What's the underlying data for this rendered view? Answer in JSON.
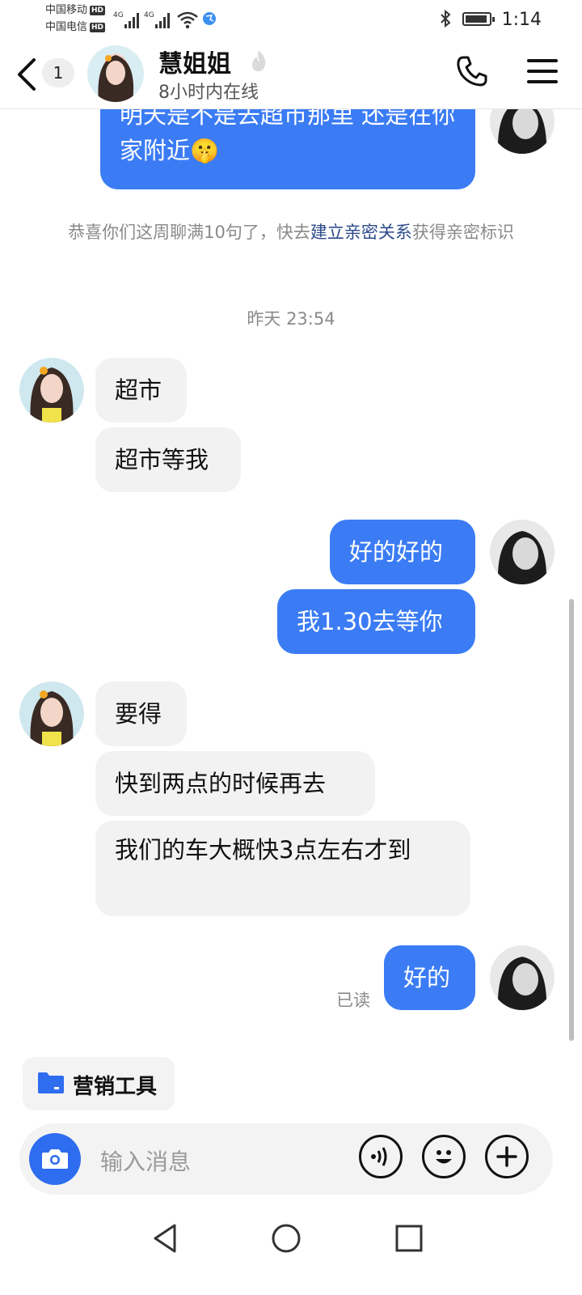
{
  "status_bar": {
    "carrier1": "中国移动",
    "carrier2": "中国电信",
    "hd_label": "HD",
    "network": "4G",
    "time": "1:14"
  },
  "header": {
    "unread_count": "1",
    "contact_name": "慧姐姐",
    "online_status": "8小时内在线"
  },
  "messages": {
    "out_top": "明天是不是去超市那里 还是在你家附近",
    "sys_notice_before": "恭喜你们这周聊满10句了，快去",
    "sys_notice_link": "建立亲密关系",
    "sys_notice_after": "获得亲密标识",
    "timestamp": "昨天 23:54",
    "in_1": "超市",
    "in_2": "超市等我",
    "out_1": "好的好的",
    "out_2": "我1.30去等你",
    "in_3": "要得",
    "in_4": "快到两点的时候再去",
    "in_5": "我们的车大概快3点左右才到",
    "out_3": "好的",
    "read_status": "已读"
  },
  "toolbar": {
    "marketing_tools": "营销工具"
  },
  "input": {
    "placeholder": "输入消息"
  },
  "colors": {
    "outgoing_bubble": "#3b7cf5",
    "incoming_bubble": "#f2f2f3",
    "accent": "#2e6cf0",
    "link": "#2d4b8a"
  },
  "icons": [
    "back-icon",
    "phone-icon",
    "menu-icon",
    "camera-icon",
    "voice-icon",
    "emoji-icon",
    "plus-icon",
    "folder-icon",
    "nav-back-icon",
    "nav-home-icon",
    "nav-recent-icon"
  ]
}
